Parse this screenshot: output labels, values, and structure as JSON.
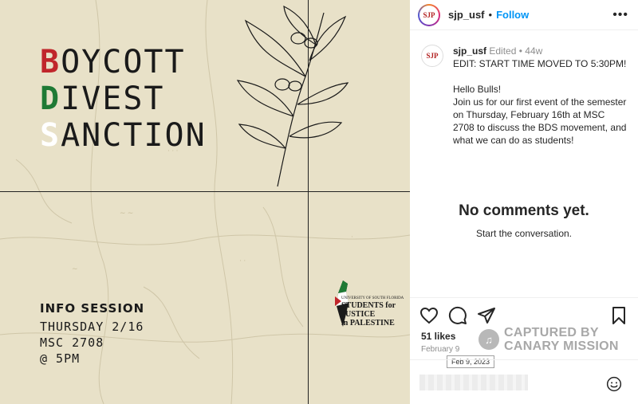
{
  "post_image": {
    "headline": [
      {
        "initial": "B",
        "rest": "OYCOTT"
      },
      {
        "initial": "D",
        "rest": "IVEST"
      },
      {
        "initial": "S",
        "rest": "ANCTION"
      }
    ],
    "info_title": "INFO SESSION",
    "info_lines": [
      "THURSDAY 2/16",
      "MSC 2708",
      "@ 5PM"
    ],
    "logo": {
      "small_text": "UNIVERSITY OF SOUTH FLORIDA",
      "line1": "STUDENTS for JUSTICE",
      "line2": "in PALESTINE"
    }
  },
  "header": {
    "username": "sjp_usf",
    "separator": "•",
    "follow_label": "Follow",
    "more_icon": "more-horizontal-icon"
  },
  "caption": {
    "username": "sjp_usf",
    "edited": "Edited",
    "dot": "•",
    "age": "44w",
    "paragraphs": [
      "EDIT: START TIME MOVED TO 5:30PM!",
      "Hello Bulls!\nJoin us for our first event of the semester on Thursday, February 16th at MSC 2708 to discuss the BDS movement, and what we can do as students!"
    ]
  },
  "avatar_text": "SJP",
  "comments": {
    "empty_title": "No comments yet.",
    "empty_subtitle": "Start the conversation."
  },
  "actions": {
    "icons": [
      "heart-icon",
      "comment-icon",
      "share-icon",
      "bookmark-icon"
    ],
    "likes": "51 likes",
    "date": "February 9",
    "date_tooltip": "Feb 9, 2023"
  },
  "watermark": {
    "line1": "CAPTURED BY",
    "line2": "CANARY MISSION"
  },
  "comment_bar": {
    "emoji_icon": "emoji-icon"
  },
  "colors": {
    "accent": "#0095f6",
    "red": "#c0262b",
    "green": "#1f7a35",
    "paper": "#e8e1c8"
  }
}
